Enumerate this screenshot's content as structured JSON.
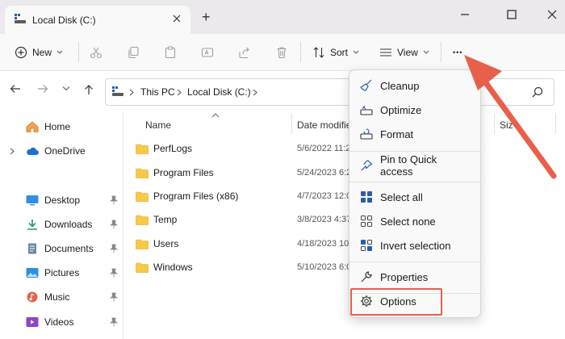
{
  "window": {
    "tab_title": "Local Disk (C:)",
    "new_tab": "+"
  },
  "toolbar": {
    "new_label": "New",
    "sort_label": "Sort",
    "view_label": "View",
    "more_label": "•••"
  },
  "address": {
    "crumbs": [
      "This PC",
      "Local Disk (C:)"
    ]
  },
  "sidebar": {
    "items": [
      {
        "label": "Home",
        "icon": "home-icon"
      },
      {
        "label": "OneDrive",
        "icon": "cloud-icon"
      },
      {
        "label": "Desktop",
        "icon": "desktop-icon"
      },
      {
        "label": "Downloads",
        "icon": "download-icon"
      },
      {
        "label": "Documents",
        "icon": "documents-icon"
      },
      {
        "label": "Pictures",
        "icon": "pictures-icon"
      },
      {
        "label": "Music",
        "icon": "music-icon"
      },
      {
        "label": "Videos",
        "icon": "videos-icon"
      }
    ]
  },
  "columns": {
    "name": "Name",
    "date": "Date modifie",
    "size": "Siz"
  },
  "files": [
    {
      "name": "PerfLogs",
      "date": "5/6/2022 11:2"
    },
    {
      "name": "Program Files",
      "date": "5/24/2023 6:2"
    },
    {
      "name": "Program Files (x86)",
      "date": "4/7/2023 12:0"
    },
    {
      "name": "Temp",
      "date": "3/8/2023 4:37"
    },
    {
      "name": "Users",
      "date": "4/18/2023 10:"
    },
    {
      "name": "Windows",
      "date": "5/10/2023 6:0"
    }
  ],
  "menu": {
    "items": [
      {
        "label": "Cleanup",
        "icon": "broom-icon"
      },
      {
        "label": "Optimize",
        "icon": "optimize-icon"
      },
      {
        "label": "Format",
        "icon": "format-icon"
      },
      {
        "label": "Pin to Quick access",
        "icon": "pin-icon"
      },
      {
        "label": "Select all",
        "icon": "select-all-icon"
      },
      {
        "label": "Select none",
        "icon": "select-none-icon"
      },
      {
        "label": "Invert selection",
        "icon": "invert-selection-icon"
      },
      {
        "label": "Properties",
        "icon": "wrench-icon"
      },
      {
        "label": "Options",
        "icon": "gear-icon"
      }
    ]
  },
  "colors": {
    "accent": "#e8604a",
    "folder": "#f7c948",
    "link_blue": "#1f6fd1"
  }
}
